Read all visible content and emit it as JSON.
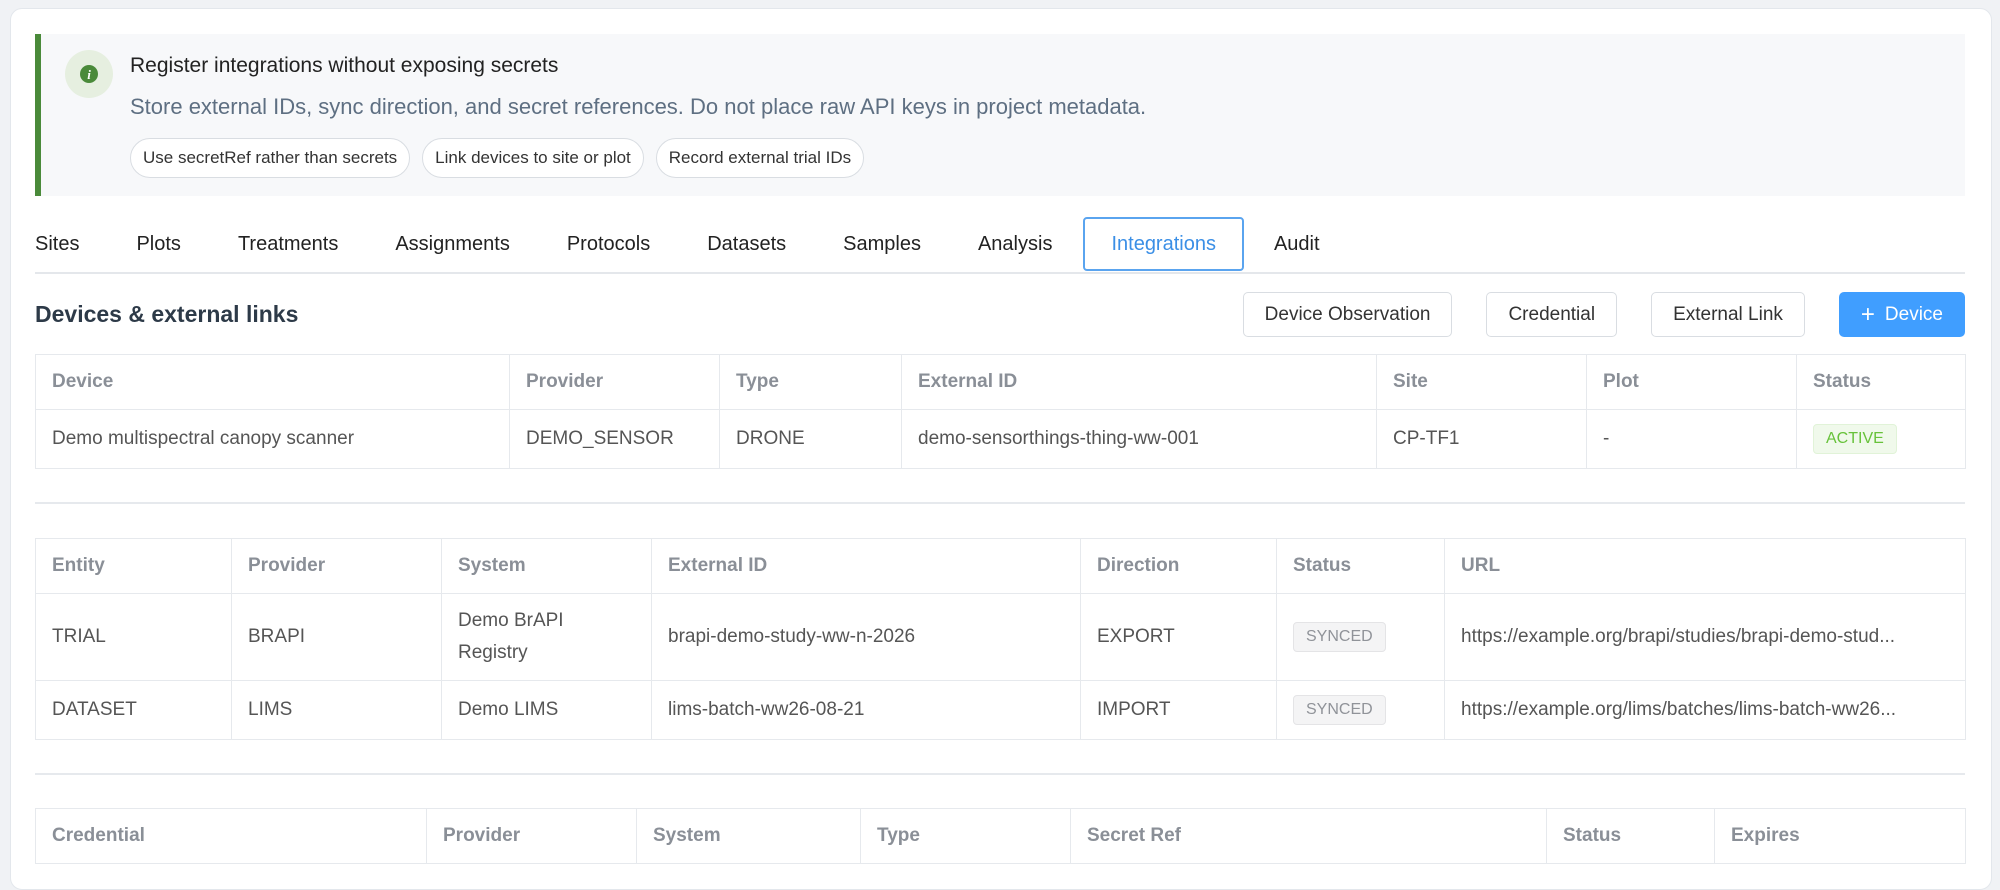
{
  "alert": {
    "title": "Register integrations without exposing secrets",
    "description": "Store external IDs, sync direction, and secret references. Do not place raw API keys in project metadata.",
    "pills": [
      "Use secretRef rather than secrets",
      "Link devices to site or plot",
      "Record external trial IDs"
    ],
    "accent_color": "#4a8a3a",
    "icon": "info-icon"
  },
  "tabs": {
    "items": [
      "Sites",
      "Plots",
      "Treatments",
      "Assignments",
      "Protocols",
      "Datasets",
      "Samples",
      "Analysis",
      "Integrations",
      "Audit"
    ],
    "active": "Integrations"
  },
  "section": {
    "title": "Devices & external links",
    "buttons": {
      "device_observation": "Device Observation",
      "credential": "Credential",
      "external_link": "External Link",
      "add_device": "Device"
    },
    "primary_color": "#409eff"
  },
  "devices_table": {
    "headers": [
      "Device",
      "Provider",
      "Type",
      "External ID",
      "Site",
      "Plot",
      "Status"
    ],
    "rows": [
      {
        "device": "Demo multispectral canopy scanner",
        "provider": "DEMO_SENSOR",
        "type": "DRONE",
        "external_id": "demo-sensorthings-thing-ww-001",
        "site": "CP-TF1",
        "plot": "-",
        "status": "ACTIVE"
      }
    ]
  },
  "links_table": {
    "headers": [
      "Entity",
      "Provider",
      "System",
      "External ID",
      "Direction",
      "Status",
      "URL"
    ],
    "rows": [
      {
        "entity": "TRIAL",
        "provider": "BRAPI",
        "system": "Demo BrAPI Registry",
        "external_id": "brapi-demo-study-ww-n-2026",
        "direction": "EXPORT",
        "status": "SYNCED",
        "url": "https://example.org/brapi/studies/brapi-demo-stud..."
      },
      {
        "entity": "DATASET",
        "provider": "LIMS",
        "system": "Demo LIMS",
        "external_id": "lims-batch-ww26-08-21",
        "direction": "IMPORT",
        "status": "SYNCED",
        "url": "https://example.org/lims/batches/lims-batch-ww26..."
      }
    ]
  },
  "credentials_table": {
    "headers": [
      "Credential",
      "Provider",
      "System",
      "Type",
      "Secret Ref",
      "Status",
      "Expires"
    ]
  }
}
